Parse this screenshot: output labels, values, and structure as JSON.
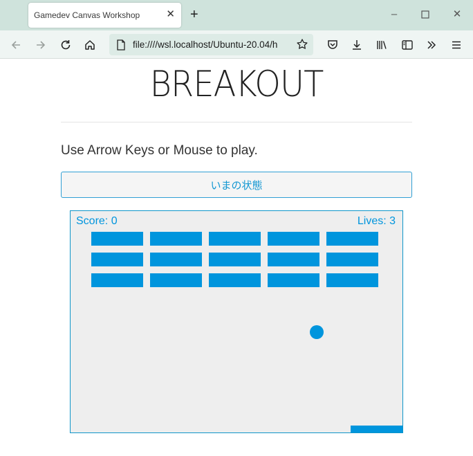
{
  "browser": {
    "tab_title": "Gamedev Canvas Workshop",
    "url": "file:////wsl.localhost/Ubuntu-20.04/h",
    "icons": [
      "close-icon",
      "plus-icon",
      "minimize-icon",
      "maximize-icon",
      "back-arrow-icon",
      "forward-arrow-icon",
      "reload-icon",
      "home-icon",
      "page-icon",
      "star-icon",
      "pocket-icon",
      "download-icon",
      "library-icon",
      "sidebar-icon",
      "chevrons-icon",
      "menu-icon"
    ]
  },
  "page": {
    "title": "BREAKOUT",
    "instructions": "Use Arrow Keys or Mouse to play.",
    "state_button": "いまの状態"
  },
  "game": {
    "score_text": "Score: 0",
    "lives_text": "Lives: 3",
    "brick_rows": 3,
    "brick_columns": 5,
    "colors": {
      "accent": "#0095dd",
      "canvas_bg": "#eeeeee"
    }
  }
}
